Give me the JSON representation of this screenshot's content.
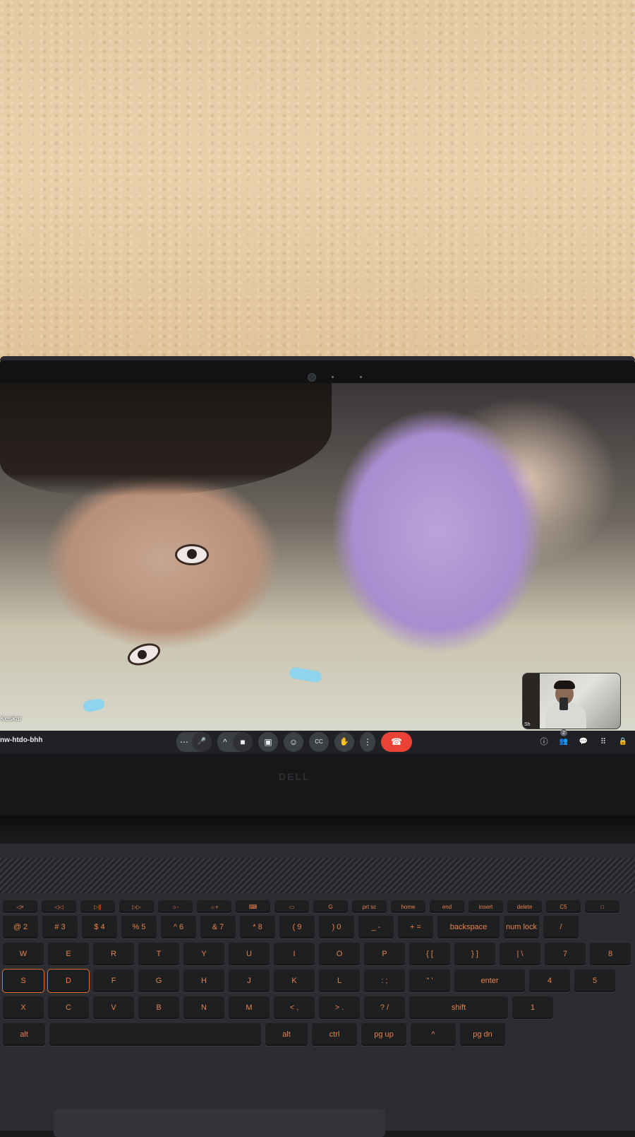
{
  "meeting": {
    "code": "nw-htdo-bhh",
    "main_participant_name": "Keskar",
    "self_view_name": "Sh",
    "participant_count": "2"
  },
  "controls": {
    "more": "⋯",
    "mic": "🎤",
    "mic_options": "^",
    "camera": "■",
    "present": "▣",
    "emoji": "☺",
    "captions": "CC",
    "raise_hand": "✋",
    "more_options": "⋮",
    "end_call": "☎"
  },
  "right_icons": {
    "info": "ⓘ",
    "people": "👥",
    "chat": "💬",
    "activities": "⠿",
    "host": "🔒"
  },
  "laptop": {
    "brand": "DELL"
  },
  "keyboard": {
    "fn_row": [
      "◁×",
      "◁◁",
      "▷||",
      "▷▷",
      "☼-",
      "☼+",
      "⌨",
      "▭",
      "G",
      "prt sc",
      "home",
      "end",
      "insert",
      "delete",
      "C5",
      "□"
    ],
    "number_row": [
      "@ 2",
      "# 3",
      "$ 4",
      "% 5",
      "^ 6",
      "& 7",
      "* 8",
      "( 9",
      ") 0",
      "_ -",
      "+ =",
      "backspace",
      "num lock",
      "/"
    ],
    "row_q": [
      "W",
      "E",
      "R",
      "T",
      "Y",
      "U",
      "I",
      "O",
      "P",
      "{ [",
      "} ]",
      "| \\",
      "7",
      "8"
    ],
    "row_a": [
      "S",
      "D",
      "F",
      "G",
      "H",
      "J",
      "K",
      "L",
      ": ;",
      "\" '",
      "enter",
      "4",
      "5"
    ],
    "row_z": [
      "X",
      "C",
      "V",
      "B",
      "N",
      "M",
      "< ,",
      "> .",
      "? /",
      "shift",
      "1"
    ],
    "row_space": [
      "alt",
      "",
      "alt",
      "ctrl",
      "pg up",
      "^",
      "pg dn"
    ]
  }
}
